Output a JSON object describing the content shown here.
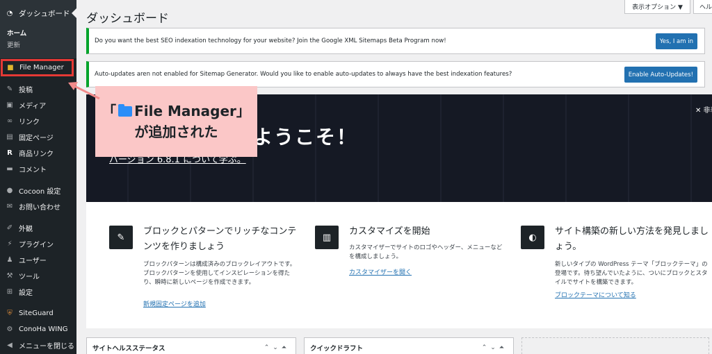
{
  "sidebar": {
    "dashboard_label": "ダッシュボード",
    "sub_items": [
      {
        "label": "ホーム"
      },
      {
        "label": "更新"
      }
    ],
    "file_manager_label": "File Manager",
    "items": [
      {
        "label": "投稿",
        "icon": "pin-icon"
      },
      {
        "label": "メディア",
        "icon": "media-icon"
      },
      {
        "label": "リンク",
        "icon": "link-icon"
      },
      {
        "label": "固定ページ",
        "icon": "page-icon"
      },
      {
        "label": "商品リンク",
        "icon": "r-icon"
      },
      {
        "label": "コメント",
        "icon": "comment-icon"
      }
    ],
    "items2": [
      {
        "label": "Cocoon 設定",
        "icon": "cocoon-icon"
      },
      {
        "label": "お問い合わせ",
        "icon": "mail-icon"
      }
    ],
    "items3": [
      {
        "label": "外観",
        "icon": "brush-icon"
      },
      {
        "label": "プラグイン",
        "icon": "plugin-icon"
      },
      {
        "label": "ユーザー",
        "icon": "user-icon"
      },
      {
        "label": "ツール",
        "icon": "wrench-icon"
      },
      {
        "label": "設定",
        "icon": "settings-icon"
      }
    ],
    "items4": [
      {
        "label": "SiteGuard",
        "icon": "siteguard-icon"
      },
      {
        "label": "ConoHa WING",
        "icon": "conoha-icon"
      },
      {
        "label": "メニューを閉じる",
        "icon": "collapse-icon"
      }
    ]
  },
  "header": {
    "screen_options": "表示オプション ▼",
    "help": "ヘル",
    "title": "ダッシュボード"
  },
  "notices": [
    {
      "text": "Do you want the best SEO indexation technology for your website? Join the Google XML Sitemaps Beta Program now!",
      "button": "Yes, I am in"
    },
    {
      "text": "Auto-updates aren not enabled for Sitemap Generator. Would you like to enable auto-updates to always have the best indexation features?",
      "button": "Enable Auto-Updates!"
    }
  ],
  "welcome": {
    "title": "ようこそ！",
    "version_link": "バージョン 6.8.1 について学ぶ。",
    "close": "✕ 非表"
  },
  "callout": {
    "line1_open": "「",
    "line1_text": "File Manager」",
    "line2": "が追加された"
  },
  "columns": [
    {
      "icon": "edit-icon",
      "heading": "ブロックとパターンでリッチなコンテンツを作りましょう",
      "body": "ブロックパターンは構成済みのブロックレイアウトです。ブロックパターンを使用してインスピレーションを得たり、瞬時に新しいページを作成できます。",
      "link": "新規固定ページを追加"
    },
    {
      "icon": "layout-icon",
      "heading": "カスタマイズを開始",
      "body": "カスタマイザーでサイトのロゴやヘッダー、メニューなどを構成しましょう。",
      "link": "カスタマイザーを開く"
    },
    {
      "icon": "contrast-icon",
      "heading": "サイト構築の新しい方法を発見しましょう。",
      "body": "新しいタイプの WordPress テーマ「ブロックテーマ」の登場です。待ち望んでいたように、ついにブロックとスタイルでサイトを構築できます。",
      "link": "ブロックテーマについて知る"
    }
  ],
  "boxes": [
    {
      "title": "サイトヘルスステータス",
      "controls": "⌃⌄⏶"
    },
    {
      "title": "クイックドラフト",
      "controls": "⌃⌄⏶"
    }
  ],
  "colors": {
    "sidebar_bg": "#1d2327",
    "accent_blue": "#2271b1",
    "notice_green": "#00a32a",
    "highlight_red": "#e53935",
    "callout_pink": "#fbc7c7"
  }
}
